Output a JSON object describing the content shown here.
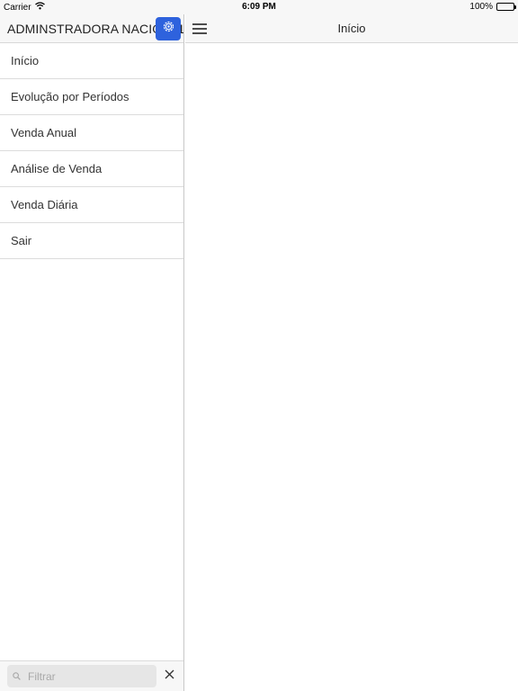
{
  "status_bar": {
    "carrier": "Carrier",
    "time": "6:09 PM",
    "battery": "100%",
    "battery_level": 1.0
  },
  "sidebar": {
    "title": "ADMINSTRADORA NACIONAL",
    "settings_icon": "gear-icon",
    "accent_color": "#2e62dd",
    "items": [
      {
        "label": "Início"
      },
      {
        "label": "Evolução por Períodos"
      },
      {
        "label": "Venda Anual"
      },
      {
        "label": "Análise de Venda"
      },
      {
        "label": "Venda Diária"
      },
      {
        "label": "Sair"
      }
    ],
    "filter": {
      "placeholder": "Filtrar",
      "value": ""
    }
  },
  "main": {
    "title": "Início"
  }
}
